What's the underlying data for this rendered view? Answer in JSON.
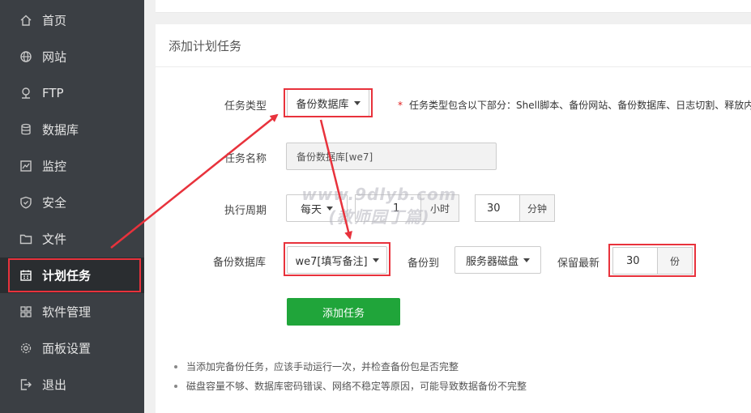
{
  "sidebar": {
    "items": [
      {
        "label": "首页",
        "icon": "home-icon"
      },
      {
        "label": "网站",
        "icon": "globe-icon"
      },
      {
        "label": "FTP",
        "icon": "ftp-icon"
      },
      {
        "label": "数据库",
        "icon": "database-icon"
      },
      {
        "label": "监控",
        "icon": "monitor-icon"
      },
      {
        "label": "安全",
        "icon": "shield-icon"
      },
      {
        "label": "文件",
        "icon": "folder-icon"
      },
      {
        "label": "计划任务",
        "icon": "calendar-icon"
      },
      {
        "label": "软件管理",
        "icon": "apps-icon"
      },
      {
        "label": "面板设置",
        "icon": "gear-icon"
      },
      {
        "label": "退出",
        "icon": "logout-icon"
      }
    ],
    "active_index": 7
  },
  "form": {
    "title": "添加计划任务",
    "task_type_label": "任务类型",
    "task_type_value": "备份数据库",
    "hint_star": "*",
    "hint_text": "任务类型包含以下部分：Shell脚本、备份网站、备份数据库、日志切割、释放内",
    "task_name_label": "任务名称",
    "task_name_value": "备份数据库[we7]",
    "period_label": "执行周期",
    "period_value": "每天",
    "hour_value": "1",
    "hour_unit": "小时",
    "minute_value": "30",
    "minute_unit": "分钟",
    "backup_db_label": "备份数据库",
    "backup_db_value": "we7[填写备注]",
    "backup_to_label": "备份到",
    "backup_to_value": "服务器磁盘",
    "keep_label": "保留最新",
    "keep_value": "30",
    "keep_unit": "份",
    "submit_label": "添加任务"
  },
  "notes": [
    "当添加完备份任务，应该手动运行一次，并检查备份包是否完整",
    "磁盘容量不够、数据库密码错误、网络不稳定等原因，可能导致数据备份不完整"
  ],
  "watermark": {
    "line1": "www.9dlyb.com",
    "line2": "(教师园丁篇)"
  },
  "colors": {
    "sidebar_bg": "#3b3f44",
    "accent_green": "#20a53a",
    "highlight_red": "#e8323c"
  }
}
